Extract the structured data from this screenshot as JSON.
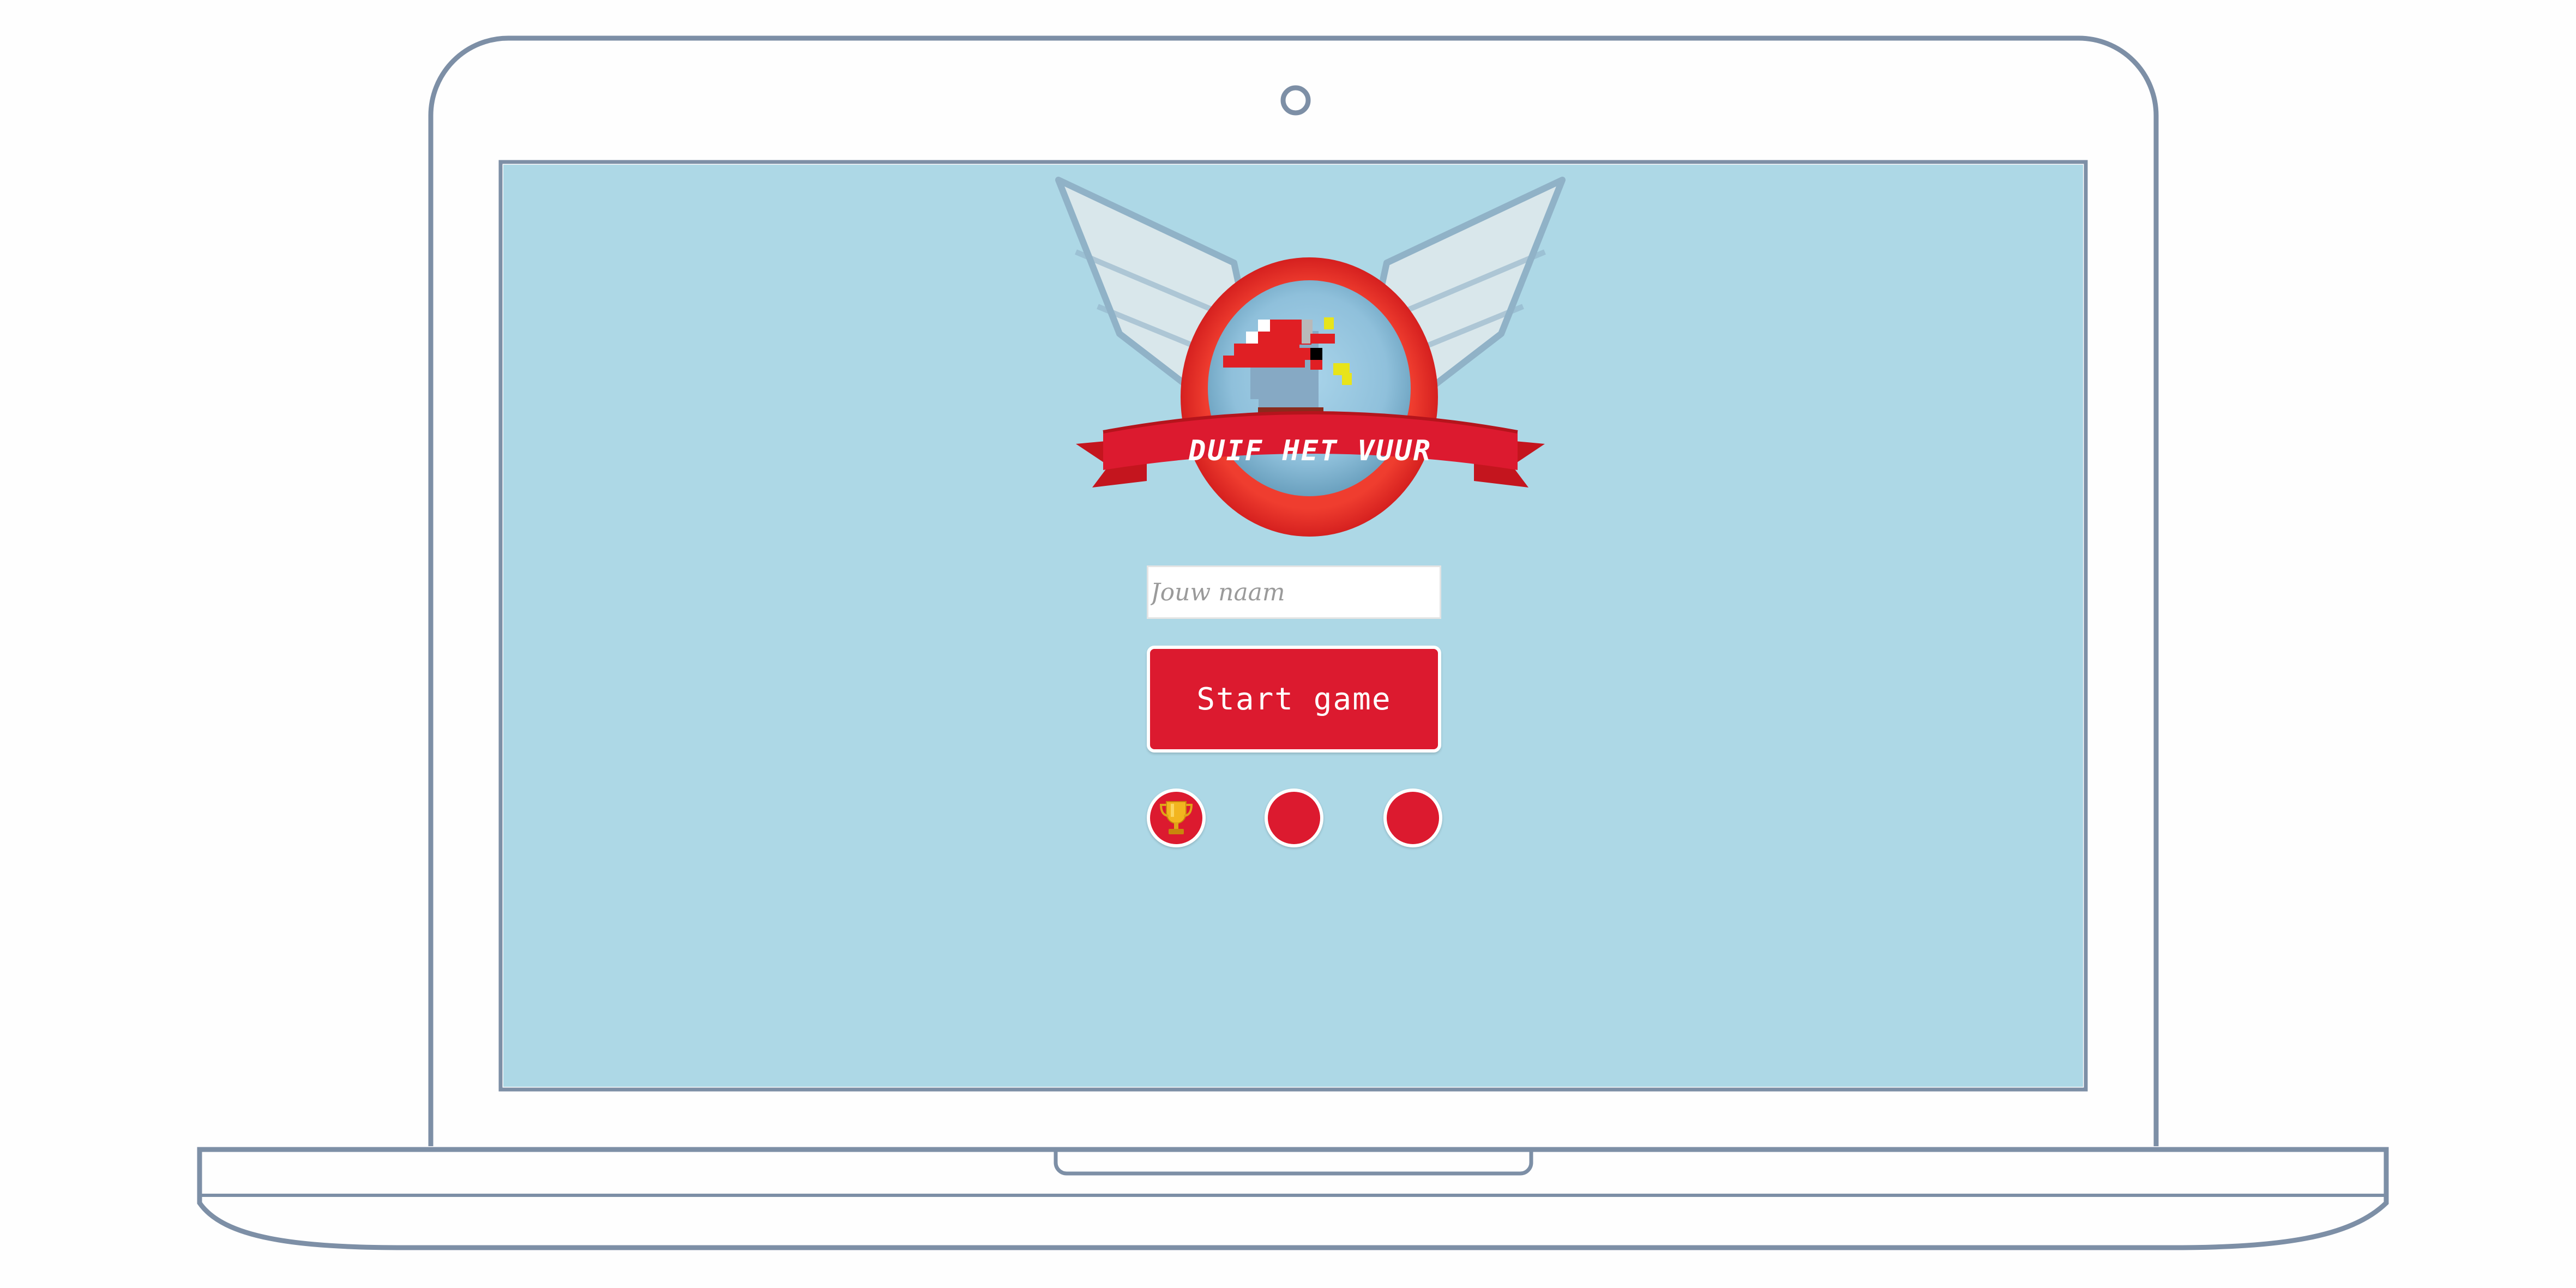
{
  "logo": {
    "title": "DUIF HET VUUR",
    "icon": "pixel-pigeon-with-red-hat"
  },
  "form": {
    "name_placeholder": "Jouw naam",
    "name_value": "",
    "start_label": "Start game"
  },
  "round_buttons": [
    {
      "icon": "trophy-icon"
    },
    {
      "icon": ""
    },
    {
      "icon": ""
    }
  ],
  "colors": {
    "screen_bg": "#add8e6",
    "accent_red": "#dc1a2f",
    "laptop_outline": "#7d8fa6",
    "trophy_gold": "#e0a418"
  }
}
